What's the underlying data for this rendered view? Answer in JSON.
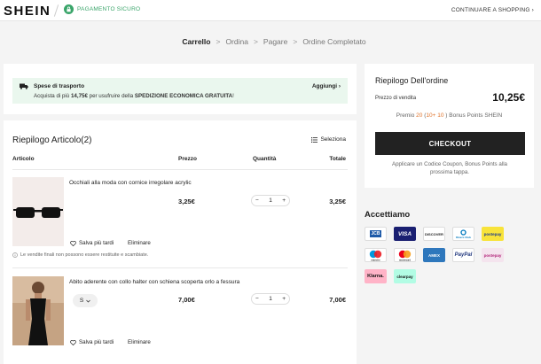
{
  "header": {
    "logo": "SHEIN",
    "secure_label": "PAGAMENTO SICURO",
    "continue_label": "CONTINUARE A SHOPPING ›"
  },
  "steps": [
    {
      "label": "Carrello",
      "active": true
    },
    {
      "label": "Ordina"
    },
    {
      "label": "Pagare"
    },
    {
      "label": "Ordine Completato"
    }
  ],
  "shipping": {
    "title": "Spese di trasporto",
    "desc_prefix": "Acquista di più ",
    "desc_amount": "14,75€",
    "desc_mid": " per usufruire della ",
    "desc_bold": "SPEDIZIONE ECONOMICA GRATUITA",
    "desc_end": "!",
    "add_label": "Aggiungi ›"
  },
  "cart": {
    "title": "Riepilogo Articolo(2)",
    "select_label": "Seleziona",
    "columns": {
      "item": "Articolo",
      "price": "Prezzo",
      "qty": "Quantità",
      "total": "Totale"
    },
    "items": [
      {
        "name": "Occhiali alla moda con cornice irregolare acrylic",
        "price": "3,25€",
        "qty": "1",
        "total": "3,25€",
        "save_label": "Salva più tardi",
        "delete_label": "Eliminare",
        "note": "Le vendite finali non possono essere restituite e scambiate."
      },
      {
        "name": "Abito aderente con collo halter con schiena scoperta orlo a fessura",
        "size": "S",
        "price": "7,00€",
        "qty": "1",
        "total": "7,00€",
        "save_label": "Salva più tardi",
        "delete_label": "Eliminare"
      }
    ],
    "qty_minus": "−",
    "qty_plus": "+"
  },
  "summary": {
    "title": "Riepilogo Dell'ordine",
    "sale_label": "Prezzo di vendita",
    "sale_value": "10,25€",
    "premio_prefix": "Premio ",
    "premio_points": "20",
    "premio_detail_open": " (",
    "premio_detail_a": "10",
    "premio_plus": "+ ",
    "premio_detail_b": "10",
    "premio_detail_close": " )",
    "premio_suffix": " Bonus Points SHEIN",
    "checkout_label": "CHECKOUT",
    "coupon_note": "Applicare un Codice Coupon, Bonus Points alla prossima tappa."
  },
  "payments": {
    "title": "Accettiamo",
    "methods": [
      "JCB",
      "VISA",
      "DISCOVER",
      "Diners Club",
      "postepay",
      "maestro",
      "mastercard",
      "AMEX",
      "PayPal",
      "postepay",
      "Klarna.",
      "clearpay"
    ]
  },
  "colors": {
    "secure_green": "#3aa56a",
    "shipping_bg": "#eaf7ee",
    "points_orange": "#e0732b",
    "checkout_bg": "#222222"
  }
}
